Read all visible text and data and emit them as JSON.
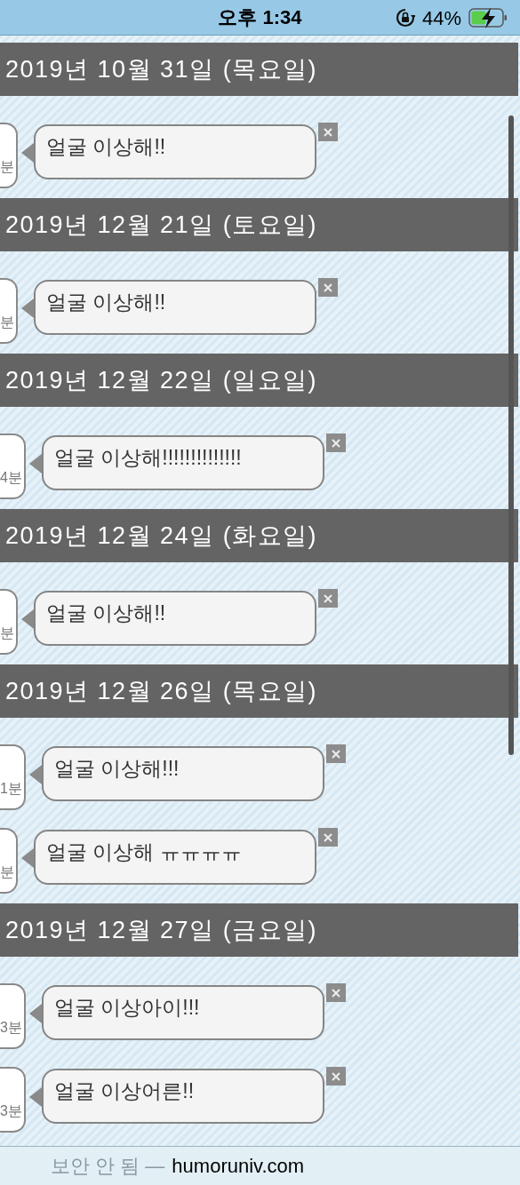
{
  "status_bar": {
    "time": "오후 1:34",
    "battery": "44%"
  },
  "days": [
    {
      "date": "2019년 10월 31일 (목요일)",
      "messages": [
        {
          "time": "분",
          "text": "얼굴 이상해!!"
        }
      ]
    },
    {
      "date": "2019년 12월 21일 (토요일)",
      "messages": [
        {
          "time": "분",
          "text": "얼굴 이상해!!"
        }
      ]
    },
    {
      "date": "2019년 12월 22일 (일요일)",
      "messages": [
        {
          "time": "4분",
          "text": "얼굴 이상해!!!!!!!!!!!!!!"
        }
      ]
    },
    {
      "date": "2019년 12월 24일 (화요일)",
      "messages": [
        {
          "time": "분",
          "text": "얼굴 이상해!!"
        }
      ]
    },
    {
      "date": "2019년 12월 26일 (목요일)",
      "messages": [
        {
          "time": "1분",
          "text": "얼굴 이상해!!!"
        },
        {
          "time": "분",
          "text": "얼굴 이상해 ㅠㅠㅠㅠ"
        }
      ]
    },
    {
      "date": "2019년 12월 27일 (금요일)",
      "messages": [
        {
          "time": "3분",
          "text": "얼굴 이상아이!!!"
        },
        {
          "time": "3분",
          "text": "얼굴 이상어른!!"
        }
      ]
    }
  ],
  "address_bar": {
    "security": "보안 안 됨 —",
    "domain": "humoruniv.com"
  }
}
